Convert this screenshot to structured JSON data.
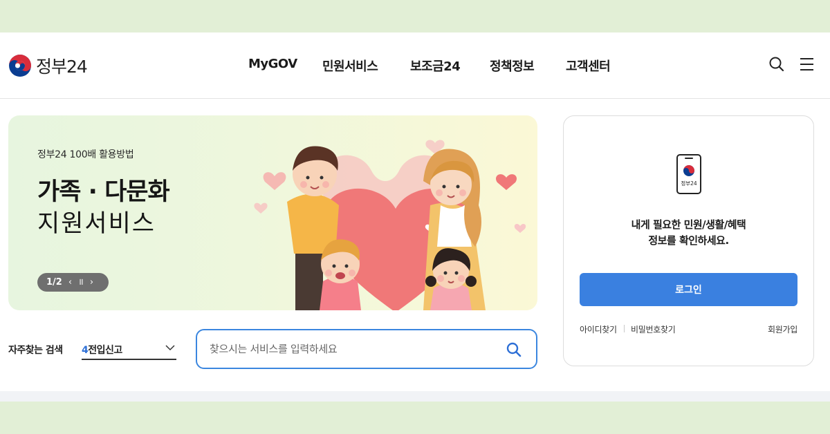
{
  "brand": {
    "name": "정부24"
  },
  "nav": {
    "items": [
      {
        "label": "MyGOV"
      },
      {
        "label": "민원서비스"
      },
      {
        "label": "보조금24"
      },
      {
        "label": "정책정보"
      },
      {
        "label": "고객센터"
      }
    ]
  },
  "header_icons": [
    "search-icon",
    "hamburger-menu-icon"
  ],
  "banner": {
    "subtitle": "정부24 100배 활용방법",
    "title_bold": "가족 · 다문화",
    "title_light": "지원서비스",
    "pager": {
      "count": "1/2",
      "prev": "‹",
      "pause": "॥",
      "next": "›"
    }
  },
  "frequent_search": {
    "label": "자주찾는 검색",
    "selected_number": "4",
    "selected_text": "전입신고"
  },
  "search": {
    "placeholder": "찾으시는 서비스를 입력하세요",
    "value": ""
  },
  "login": {
    "phone_brand": "정부24",
    "message_line1": "내게 필요한 민원/생활/혜택",
    "message_line2": "정보를 확인하세요.",
    "button": "로그인",
    "find_id": "아이디찾기",
    "find_password": "비밀번호찾기",
    "signup": "회원가입"
  },
  "colors": {
    "accent": "#3a80e0",
    "search_border": "#3a86df",
    "outer_background": "#e2efd6",
    "heart": "#f07878"
  }
}
